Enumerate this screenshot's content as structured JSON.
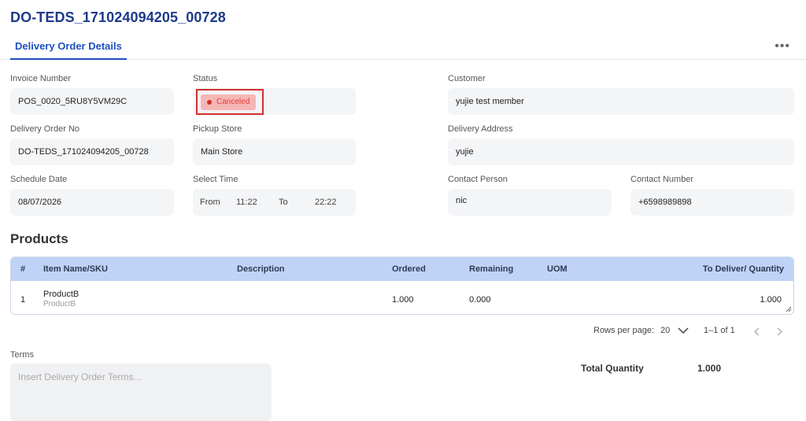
{
  "page_title": "DO-TEDS_171024094205_00728",
  "tabs": [
    {
      "label": "Delivery Order Details"
    }
  ],
  "more_label": "•••",
  "fields": {
    "invoice_number": {
      "label": "Invoice Number",
      "value": "POS_0020_5RU8Y5VM29C"
    },
    "status": {
      "label": "Status",
      "value": "Canceled",
      "color": "#e53935"
    },
    "customer": {
      "label": "Customer",
      "value": "yujie test member"
    },
    "delivery_order_no": {
      "label": "Delivery Order No",
      "value": "DO-TEDS_171024094205_00728"
    },
    "pickup_store": {
      "label": "Pickup Store",
      "value": "Main Store"
    },
    "delivery_address": {
      "label": "Delivery Address",
      "value": "yujie"
    },
    "schedule_date": {
      "label": "Schedule Date",
      "value": "08/07/2026"
    },
    "select_time": {
      "label": "Select Time",
      "from_label": "From",
      "from_value": "11:22",
      "to_label": "To",
      "to_value": "22:22"
    },
    "contact_person": {
      "label": "Contact Person",
      "value": "nic"
    },
    "contact_number": {
      "label": "Contact Number",
      "value": "+6598989898"
    }
  },
  "products": {
    "title": "Products",
    "columns": [
      "#",
      "Item Name/SKU",
      "Description",
      "Ordered",
      "Remaining",
      "UOM",
      "To Deliver/ Quantity"
    ],
    "rows": [
      {
        "index": "1",
        "name": "ProductB",
        "sku": "ProductB",
        "description": "",
        "ordered": "1.000",
        "remaining": "0.000",
        "uom": "",
        "to_deliver": "1.000"
      }
    ]
  },
  "pagination": {
    "rows_per_page_label": "Rows per page:",
    "rows_per_page": "20",
    "range": "1–1 of 1"
  },
  "terms": {
    "label": "Terms",
    "placeholder": "Insert Delivery Order Terms..."
  },
  "total": {
    "label": "Total Quantity",
    "value": "1.000"
  },
  "colors": {
    "accent": "#1e4fbf",
    "title": "#1e3a8a",
    "table_header": "#bfd3f7",
    "status_bg": "#f6b6b6",
    "highlight": "#d32f2f"
  }
}
